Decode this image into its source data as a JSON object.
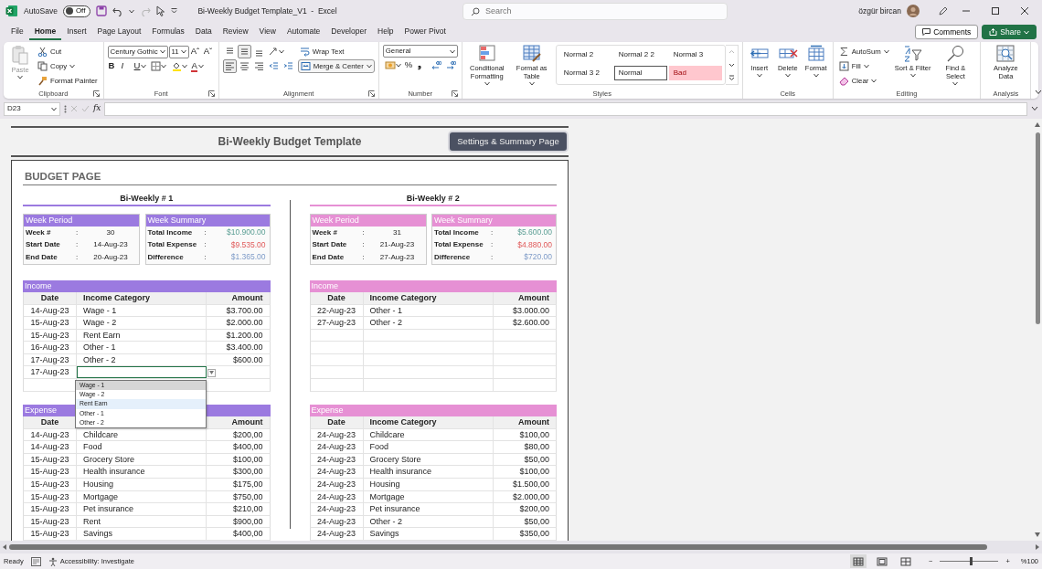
{
  "title_bar": {
    "autosave_label": "AutoSave",
    "autosave": {
      "on": false,
      "text": "Off"
    },
    "redo_disabled": true,
    "document_title": "Bi-Weekly Budget Template_V1  -  Excel",
    "search_placeholder": "Search",
    "user_name": "özgür bircan"
  },
  "menu_tabs": [
    {
      "label": "File",
      "selected": false
    },
    {
      "label": "Home",
      "selected": true
    },
    {
      "label": "Insert",
      "selected": false
    },
    {
      "label": "Page Layout",
      "selected": false
    },
    {
      "label": "Formulas",
      "selected": false
    },
    {
      "label": "Data",
      "selected": false
    },
    {
      "label": "Review",
      "selected": false
    },
    {
      "label": "View",
      "selected": false
    },
    {
      "label": "Automate",
      "selected": false
    },
    {
      "label": "Developer",
      "selected": false
    },
    {
      "label": "Help",
      "selected": false
    },
    {
      "label": "Power Pivot",
      "selected": false
    }
  ],
  "actions": [
    {
      "label": "Comments",
      "kind": "comments"
    },
    {
      "label": "Share",
      "kind": "share"
    }
  ],
  "ribbon": [
    {
      "label": "Clipboard",
      "launcher": true,
      "items": [
        {
          "kind": "big",
          "label": "Paste",
          "disabled": true,
          "dropdown": true
        },
        {
          "kind": "column",
          "items": [
            {
              "kind": "small",
              "label": "Cut"
            },
            {
              "kind": "small",
              "label": "Copy",
              "dropdown": true
            },
            {
              "kind": "small",
              "label": "Format Painter"
            }
          ]
        }
      ]
    },
    {
      "label": "Font",
      "launcher": true,
      "items": [
        {
          "kind": "column",
          "items": [
            {
              "kind": "row",
              "items": [
                {
                  "kind": "combo",
                  "value": "Century Gothic"
                },
                {
                  "kind": "combo",
                  "value": "11"
                },
                {
                  "kind": "grow",
                  "label": "Aˆ"
                },
                {
                  "kind": "shrink",
                  "label": "Aˇ"
                }
              ]
            },
            {
              "kind": "row",
              "items": [
                {
                  "kind": "bold",
                  "label": "B"
                },
                {
                  "kind": "italic",
                  "label": "I"
                },
                {
                  "kind": "underline",
                  "label": "U",
                  "dropdown": true
                },
                {
                  "kind": "tool",
                  "selected": false,
                  "dropdown": true
                },
                {
                  "kind": "tool",
                  "selected": false,
                  "dropdown": true
                },
                {
                  "kind": "fontcolor",
                  "label": "A",
                  "dropdown": true
                }
              ]
            }
          ]
        }
      ]
    },
    {
      "label": "Alignment",
      "launcher": true,
      "items": [
        {
          "kind": "column",
          "items": [
            {
              "kind": "row",
              "items": [
                {
                  "kind": "tool",
                  "selected": false
                },
                {
                  "kind": "tool",
                  "selected": true
                },
                {
                  "kind": "tool",
                  "selected": false
                },
                {
                  "kind": "tool",
                  "selected": false,
                  "dropdown": true
                }
              ]
            },
            {
              "kind": "row",
              "items": [
                {
                  "kind": "tool",
                  "selected": true
                },
                {
                  "kind": "tool",
                  "selected": false
                },
                {
                  "kind": "tool",
                  "selected": false
                },
                {
                  "kind": "tool",
                  "selected": false
                },
                {
                  "kind": "tool",
                  "selected": false
                }
              ]
            }
          ]
        },
        {
          "kind": "column",
          "items": [
            {
              "kind": "small",
              "label": "Wrap Text"
            },
            {
              "kind": "small",
              "label": "Merge & Center",
              "boxed": true,
              "dropdown": true
            }
          ]
        }
      ]
    },
    {
      "label": "Number",
      "launcher": true,
      "items": [
        {
          "kind": "column",
          "items": [
            {
              "kind": "combo",
              "value": "General"
            },
            {
              "kind": "row",
              "items": [
                {
                  "kind": "tool",
                  "selected": false,
                  "dropdown": true
                },
                {
                  "kind": "percent",
                  "label": "%"
                },
                {
                  "kind": "comma",
                  "label": "❟"
                },
                {
                  "kind": "tool",
                  "selected": false
                },
                {
                  "kind": "tool",
                  "selected": false
                }
              ]
            }
          ]
        }
      ]
    },
    {
      "label": "Styles",
      "items": [
        {
          "kind": "big",
          "label": "Conditional Formatting",
          "dropdown": true
        },
        {
          "kind": "big",
          "label": "Format as Table",
          "dropdown": true
        },
        {
          "kind": "gallery",
          "styles": [
            {
              "label": "Normal 2",
              "kind": "plain",
              "selected": false
            },
            {
              "label": "Normal 2 2",
              "kind": "plain",
              "selected": false
            },
            {
              "label": "Normal 3",
              "kind": "plain",
              "selected": false
            },
            {
              "label": "Normal 3 2",
              "kind": "plain",
              "selected": false
            },
            {
              "label": "Normal",
              "kind": "plain",
              "selected": true
            },
            {
              "label": "Bad",
              "kind": "bad",
              "selected": false
            }
          ]
        }
      ]
    },
    {
      "label": "Cells",
      "items": [
        {
          "kind": "big",
          "label": "Insert",
          "dropdown": true
        },
        {
          "kind": "big",
          "label": "Delete",
          "dropdown": true
        },
        {
          "kind": "big",
          "label": "Format",
          "dropdown": true
        }
      ]
    },
    {
      "label": "Editing",
      "items": [
        {
          "kind": "column",
          "items": [
            {
              "kind": "small",
              "label": "AutoSum",
              "dropdown": true
            },
            {
              "kind": "small",
              "label": "Fill",
              "dropdown": true
            },
            {
              "kind": "small",
              "label": "Clear",
              "dropdown": true
            }
          ]
        },
        {
          "kind": "big",
          "label": "Sort & Filter",
          "dropdown": true
        },
        {
          "kind": "big",
          "label": "Find & Select",
          "dropdown": true
        }
      ]
    },
    {
      "label": "Analysis",
      "items": [
        {
          "kind": "big",
          "label": "Analyze Data"
        }
      ]
    }
  ],
  "formula_bar": {
    "name_box": "D23",
    "fx": "fx"
  },
  "sheet": {
    "header_title": "Bi-Weekly Budget Template",
    "header_button": "Settings & Summary Page",
    "page_title": "BUDGET PAGE",
    "periods": [
      {
        "title": "Bi-Weekly # 1",
        "color": "#9b7ae0",
        "week_period": {
          "header": "Week Period",
          "rows": [
            {
              "label": "Week #",
              "sep": ":",
              "value": "30"
            },
            {
              "label": "Start Date",
              "sep": ":",
              "value": "14-Aug-23"
            },
            {
              "label": "End Date",
              "sep": ":",
              "value": "20-Aug-23"
            }
          ]
        },
        "week_summary": {
          "header": "Week Summary",
          "rows": [
            {
              "label": "Total Income",
              "sep": ":",
              "value": "$10.900.00",
              "kind": "income"
            },
            {
              "label": "Total Expense",
              "sep": ":",
              "value": "$9.535.00",
              "kind": "expense"
            },
            {
              "label": "Difference",
              "sep": ":",
              "value": "$1.365.00",
              "kind": "difference"
            }
          ]
        },
        "income": {
          "header": "Income",
          "columns": {
            "date": "Date",
            "category": "Income Category",
            "amount": "Amount"
          },
          "rows": [
            {
              "date": "14-Aug-23",
              "category": "Wage - 1",
              "amount": "$3.700.00",
              "active": false
            },
            {
              "date": "15-Aug-23",
              "category": "Wage - 2",
              "amount": "$2.000.00",
              "active": false
            },
            {
              "date": "15-Aug-23",
              "category": "Rent Earn",
              "amount": "$1.200.00",
              "active": false
            },
            {
              "date": "16-Aug-23",
              "category": "Other - 1",
              "amount": "$3.400.00",
              "active": false
            },
            {
              "date": "17-Aug-23",
              "category": "Other - 2",
              "amount": "$600.00",
              "active": false
            },
            {
              "date": "17-Aug-23",
              "active": true,
              "dropdown": [
                {
                  "label": "Wage - 1",
                  "selected": true,
                  "hovered": false
                },
                {
                  "label": "Wage - 2",
                  "selected": false,
                  "hovered": false
                },
                {
                  "label": "Rent Earn",
                  "selected": false,
                  "hovered": true
                },
                {
                  "label": "Other - 1",
                  "selected": false,
                  "hovered": false
                },
                {
                  "label": "Other - 2",
                  "selected": false,
                  "hovered": false
                }
              ]
            }
          ]
        },
        "expense": {
          "header": "Expense",
          "columns": {
            "date": "Date",
            "amount": "Amount"
          },
          "rows": [
            {
              "date": "14-Aug-23",
              "category": "Childcare",
              "amount": "$200,00",
              "active": false
            },
            {
              "date": "14-Aug-23",
              "category": "Food",
              "amount": "$400,00",
              "active": false
            },
            {
              "date": "15-Aug-23",
              "category": "Grocery Store",
              "amount": "$100,00",
              "active": false
            },
            {
              "date": "15-Aug-23",
              "category": "Health insurance",
              "amount": "$300,00",
              "active": false
            },
            {
              "date": "15-Aug-23",
              "category": "Housing",
              "amount": "$175,00",
              "active": false
            },
            {
              "date": "15-Aug-23",
              "category": "Mortgage",
              "amount": "$750,00",
              "active": false
            },
            {
              "date": "15-Aug-23",
              "category": "Pet insurance",
              "amount": "$210,00",
              "active": false
            },
            {
              "date": "15-Aug-23",
              "category": "Rent",
              "amount": "$900,00",
              "active": false
            },
            {
              "date": "15-Aug-23",
              "category": "Savings",
              "amount": "$400,00",
              "active": false
            }
          ]
        }
      },
      {
        "title": "Bi-Weekly # 2",
        "color": "#e690d4",
        "week_period": {
          "header": "Week Period",
          "rows": [
            {
              "label": "Week #",
              "sep": ":",
              "value": "31"
            },
            {
              "label": "Start Date",
              "sep": ":",
              "value": "21-Aug-23"
            },
            {
              "label": "End Date",
              "sep": ":",
              "value": "27-Aug-23"
            }
          ]
        },
        "week_summary": {
          "header": "Week Summary",
          "rows": [
            {
              "label": "Total Income",
              "sep": ":",
              "value": "$5.600.00",
              "kind": "income"
            },
            {
              "label": "Total Expense",
              "sep": ":",
              "value": "$4.880.00",
              "kind": "expense"
            },
            {
              "label": "Difference",
              "sep": ":",
              "value": "$720.00",
              "kind": "difference"
            }
          ]
        },
        "income": {
          "header": "Income",
          "columns": {
            "date": "Date",
            "category": "Income Category",
            "amount": "Amount"
          },
          "rows": [
            {
              "date": "22-Aug-23",
              "category": "Other - 1",
              "amount": "$3.000.00",
              "active": false
            },
            {
              "date": "27-Aug-23",
              "category": "Other - 2",
              "amount": "$2.600.00",
              "active": false
            }
          ]
        },
        "expense": {
          "header": "Expense",
          "columns": {
            "date": "Date",
            "category": "Income Category",
            "amount": "Amount"
          },
          "rows": [
            {
              "date": "24-Aug-23",
              "category": "Childcare",
              "amount": "$100,00",
              "active": false
            },
            {
              "date": "24-Aug-23",
              "category": "Food",
              "amount": "$80,00",
              "active": false
            },
            {
              "date": "24-Aug-23",
              "category": "Grocery Store",
              "amount": "$50,00",
              "active": false
            },
            {
              "date": "24-Aug-23",
              "category": "Health insurance",
              "amount": "$100,00",
              "active": false
            },
            {
              "date": "24-Aug-23",
              "category": "Housing",
              "amount": "$1.500,00",
              "active": false
            },
            {
              "date": "24-Aug-23",
              "category": "Mortgage",
              "amount": "$2.000,00",
              "active": false
            },
            {
              "date": "24-Aug-23",
              "category": "Pet insurance",
              "amount": "$200,00",
              "active": false
            },
            {
              "date": "24-Aug-23",
              "category": "Other - 2",
              "amount": "$50,00",
              "active": false
            },
            {
              "date": "24-Aug-23",
              "category": "Savings",
              "amount": "$350,00",
              "active": false
            }
          ]
        }
      }
    ]
  },
  "status_bar": {
    "ready": "Ready",
    "accessibility": "Accessibility: Investigate",
    "views": [
      {
        "selected": true
      },
      {
        "selected": false
      },
      {
        "selected": false
      }
    ],
    "zoom_out": "−",
    "zoom_in": "+",
    "zoom": {
      "level": 0.52
    },
    "zoom_text": "%100"
  }
}
